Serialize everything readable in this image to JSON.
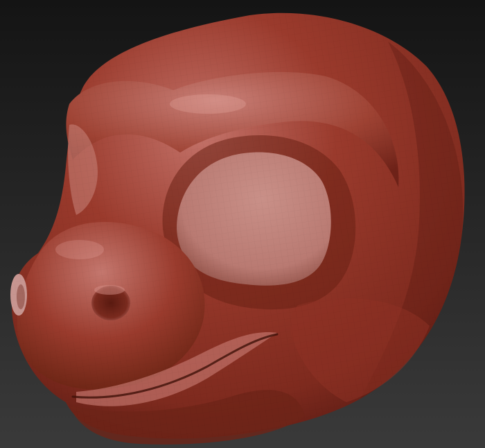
{
  "scene": {
    "subject": "sculpted-creature-head-model",
    "colors": {
      "background_top": "#141414",
      "background_bottom": "#3a3a3a",
      "clay_highlight": "#c4736a",
      "clay_mid": "#9a3a2c",
      "clay_base": "#7e2a1e",
      "clay_shadow": "#4a140e",
      "eye_socket": "#b97a72",
      "eye_socket_light": "#c99088"
    }
  }
}
